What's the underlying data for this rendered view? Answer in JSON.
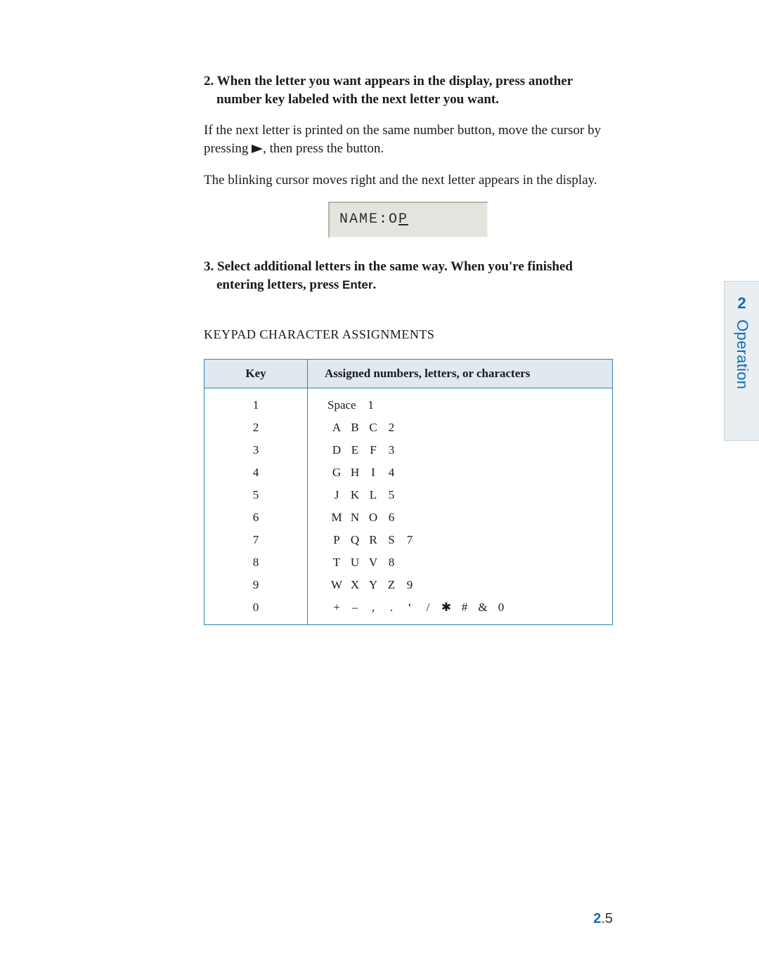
{
  "side_tab": {
    "number": "2",
    "label": "Operation"
  },
  "page_number": {
    "chapter": "2",
    "separator": ".",
    "page": "5"
  },
  "steps": {
    "s2": {
      "bold": "2. When the letter you want appears in the display, press another number key labeled with the next letter you want.",
      "body1_a": "If the next letter is printed on the same number button, move the cursor by pressing ",
      "body1_b": ", then press the button.",
      "body2": "The blinking cursor moves right and the next letter appears in the display."
    },
    "s3": {
      "bold_a": "3. Select additional letters in the same way. When you're finished entering letters, press ",
      "enter_label": "Enter",
      "bold_b": "."
    }
  },
  "lcd": {
    "prefix": "NAME:O",
    "cursor_char": "P"
  },
  "heading": "KEYPAD CHARACTER ASSIGNMENTS",
  "table": {
    "header_key": "Key",
    "header_val": "Assigned numbers, letters, or characters",
    "rows": [
      {
        "key": "1",
        "chars": [
          "Space",
          "1"
        ]
      },
      {
        "key": "2",
        "chars": [
          "A",
          "B",
          "C",
          "2"
        ]
      },
      {
        "key": "3",
        "chars": [
          "D",
          "E",
          "F",
          "3"
        ]
      },
      {
        "key": "4",
        "chars": [
          "G",
          "H",
          "I",
          "4"
        ]
      },
      {
        "key": "5",
        "chars": [
          "J",
          "K",
          "L",
          "5"
        ]
      },
      {
        "key": "6",
        "chars": [
          "M",
          "N",
          "O",
          "6"
        ]
      },
      {
        "key": "7",
        "chars": [
          "P",
          "Q",
          "R",
          "S",
          "7"
        ]
      },
      {
        "key": "8",
        "chars": [
          "T",
          "U",
          "V",
          "8"
        ]
      },
      {
        "key": "9",
        "chars": [
          "W",
          "X",
          "Y",
          "Z",
          "9"
        ]
      },
      {
        "key": "0",
        "chars": [
          "+",
          "–",
          ",",
          ".",
          "‘",
          "/",
          "✱",
          "#",
          "&",
          "0"
        ]
      }
    ]
  }
}
